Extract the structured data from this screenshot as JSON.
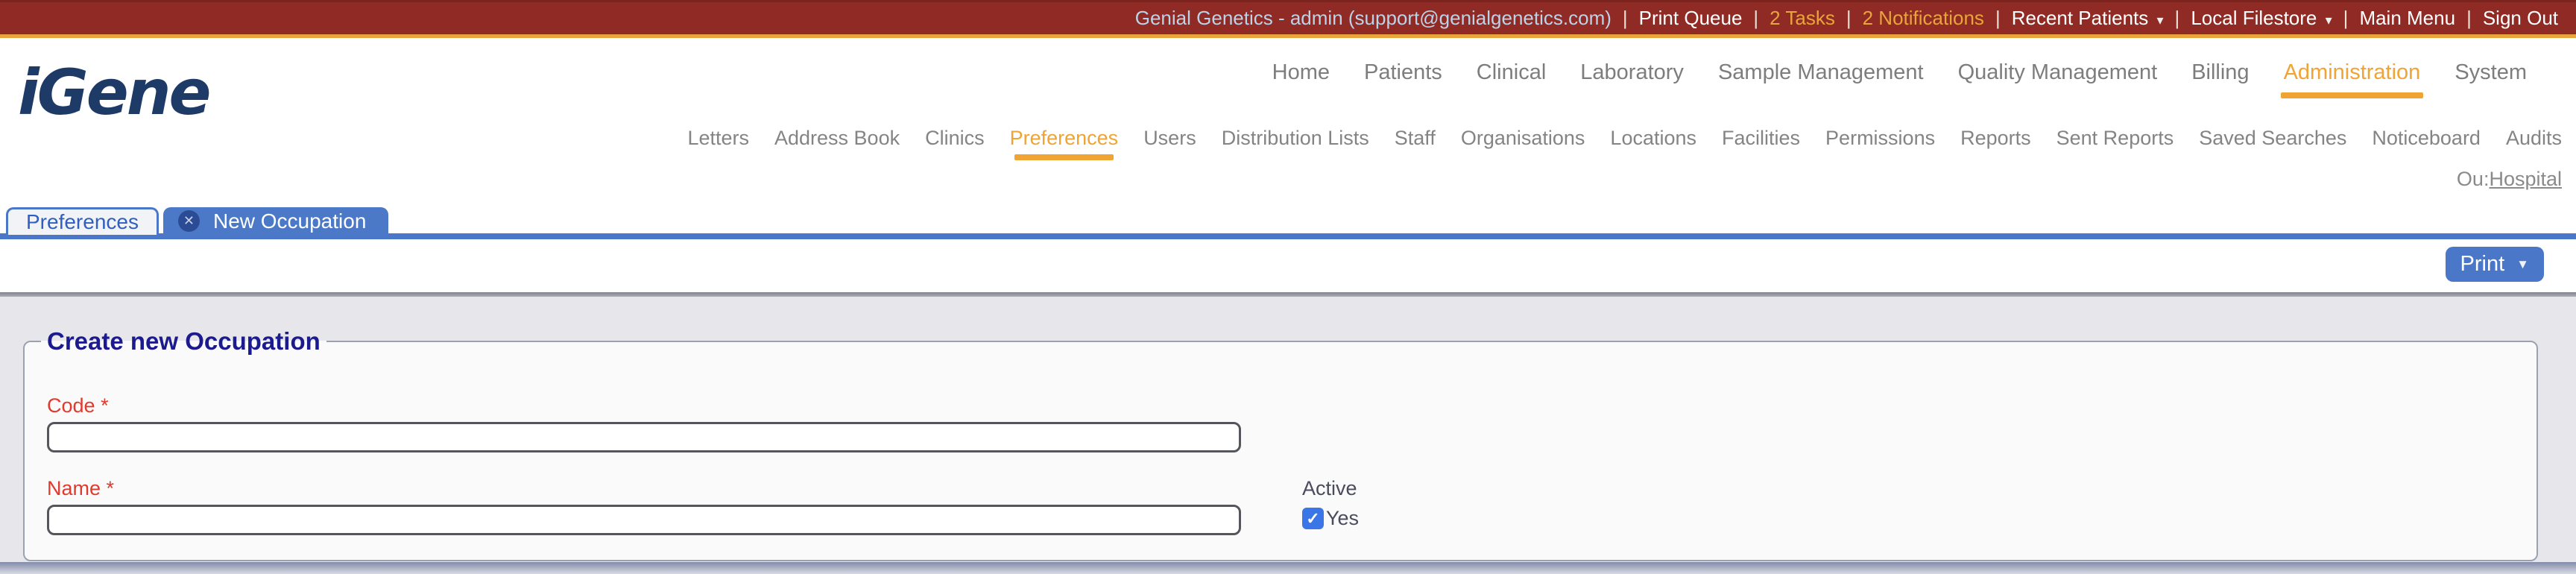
{
  "topbar": {
    "user_info": "Genial Genetics - admin (support@genialgenetics.com)",
    "separator": "|",
    "print_queue": "Print Queue",
    "tasks": "2 Tasks",
    "notifications": "2 Notifications",
    "recent_patients": "Recent Patients",
    "local_filestore": "Local Filestore",
    "main_menu": "Main Menu",
    "sign_out": "Sign Out"
  },
  "branding": {
    "logo_text": "iGene"
  },
  "main_nav": {
    "active_item": "Administration",
    "items": [
      "Home",
      "Patients",
      "Clinical",
      "Laboratory",
      "Sample Management",
      "Quality Management",
      "Billing",
      "Administration",
      "System"
    ]
  },
  "sub_nav": {
    "active_item": "Preferences",
    "items": [
      "Letters",
      "Address Book",
      "Clinics",
      "Preferences",
      "Users",
      "Distribution Lists",
      "Staff",
      "Organisations",
      "Locations",
      "Facilities",
      "Permissions",
      "Reports",
      "Sent Reports",
      "Saved Searches",
      "Noticeboard",
      "Audits"
    ]
  },
  "org_unit": {
    "prefix": "Ou:",
    "value": "Hospital"
  },
  "tabs": {
    "items": [
      {
        "label": "Preferences",
        "active": false
      },
      {
        "label": "New Occupation",
        "active": true,
        "closable": true
      }
    ]
  },
  "toolbar": {
    "print_label": "Print"
  },
  "form": {
    "legend": "Create new Occupation",
    "required_marker": "*",
    "code_label": "Code",
    "code_value": "",
    "name_label": "Name",
    "name_value": "",
    "active_label": "Active",
    "active_option_label": "Yes",
    "active_checked": true
  },
  "icons": {
    "dropdown_arrow": "▾",
    "print_dropdown_arrow": "▼",
    "close": "✕",
    "check": "✓"
  },
  "colors": {
    "topbar_bg": "#8F2B24",
    "accent_orange": "#E9A43C",
    "nav_active_orange": "#F0A434",
    "tab_blue": "#4A77C8",
    "logo_navy": "#1E3A67",
    "legend_navy": "#1B1B8F",
    "required_red": "#E1392C",
    "checkbox_blue": "#3B76E9",
    "content_bg": "#E7E7EB"
  }
}
